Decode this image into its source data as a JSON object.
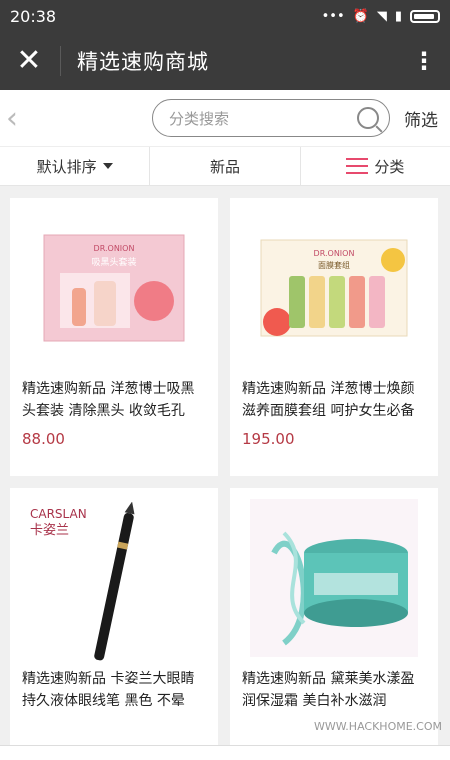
{
  "status": {
    "time": "20:38"
  },
  "header": {
    "title": "精选速购商城"
  },
  "search": {
    "placeholder": "分类搜索",
    "filter_label": "筛选"
  },
  "sort": {
    "default": "默认排序",
    "new": "新品",
    "category": "分类"
  },
  "products": [
    {
      "title": "精选速购新品 洋葱博士吸黑头套装 清除黑头 收敛毛孔",
      "price": "88.00",
      "img_brand": "DR.ONION",
      "img_text": "吸黑头套装"
    },
    {
      "title": "精选速购新品 洋葱博士焕颜滋养面膜套组 呵护女生必备",
      "price": "195.00",
      "img_brand": "DR.ONION",
      "img_text": "面膜套组"
    },
    {
      "title": "精选速购新品 卡姿兰大眼睛持久液体眼线笔 黑色 不晕",
      "price": "",
      "img_brand": "CARSLAN",
      "img_text": "卡姿兰"
    },
    {
      "title": "精选速购新品 黛莱美水漾盈润保湿霜 美白补水滋润",
      "price": "",
      "img_brand": "",
      "img_text": ""
    }
  ],
  "watermark": "WWW.HACKHOME.COM",
  "colors": {
    "accent": "#e74a6d",
    "price": "#b53a45",
    "header": "#3b3b3b"
  }
}
